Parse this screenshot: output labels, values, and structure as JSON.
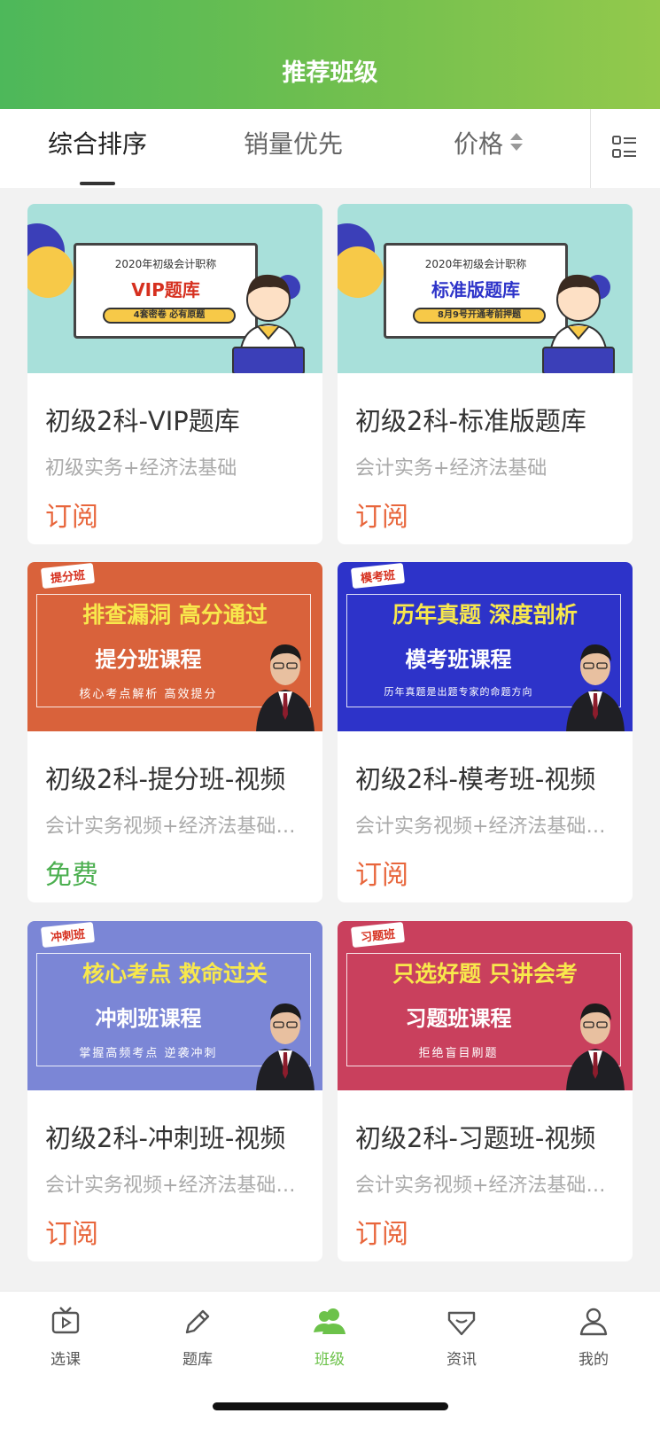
{
  "header": {
    "title": "推荐班级"
  },
  "tabs": [
    {
      "label": "综合排序"
    },
    {
      "label": "销量优先"
    },
    {
      "label": "价格"
    }
  ],
  "cards": [
    {
      "title": "初级2科-VIP题库",
      "subtitle": "初级实务+经济法基础",
      "price": "订阅",
      "thumb": {
        "line1": "2020年初级会计职称",
        "line2": "VIP题库",
        "line3": "4套密卷 必有原题"
      }
    },
    {
      "title": "初级2科-标准版题库",
      "subtitle": "会计实务+经济法基础",
      "price": "订阅",
      "thumb": {
        "line1": "2020年初级会计职称",
        "line2": "标准版题库",
        "line3": "8月9号开通考前押题"
      }
    },
    {
      "title": "初级2科-提分班-视频",
      "subtitle": "会计实务视频+经济法基础视频",
      "price": "免费",
      "thumb": {
        "tag": "提分班",
        "headline": "排查漏洞 高分通过",
        "course": "提分班课程",
        "small": "核心考点解析 高效提分",
        "bg": "#d9623b"
      }
    },
    {
      "title": "初级2科-模考班-视频",
      "subtitle": "会计实务视频+经济法基础视频",
      "price": "订阅",
      "thumb": {
        "tag": "模考班",
        "headline": "历年真题 深度剖析",
        "course": "模考班课程",
        "small": "历年真题是出题专家的命题方向",
        "bg": "#2d33c9"
      }
    },
    {
      "title": "初级2科-冲刺班-视频",
      "subtitle": "会计实务视频+经济法基础视频",
      "price": "订阅",
      "thumb": {
        "tag": "冲刺班",
        "headline": "核心考点 救命过关",
        "course": "冲刺班课程",
        "small": "掌握高频考点 逆袭冲刺",
        "bg": "#7b86d6"
      }
    },
    {
      "title": "初级2科-习题班-视频",
      "subtitle": "会计实务视频+经济法基础视频",
      "price": "订阅",
      "thumb": {
        "tag": "习题班",
        "headline": "只选好题 只讲会考",
        "course": "习题班课程",
        "small": "拒绝盲目刷题",
        "bg": "#c9405d"
      }
    }
  ],
  "bottom_nav": [
    {
      "label": "选课",
      "icon": "tv-icon"
    },
    {
      "label": "题库",
      "icon": "pencil-icon"
    },
    {
      "label": "班级",
      "icon": "group-icon",
      "active": true
    },
    {
      "label": "资讯",
      "icon": "diamond-icon"
    },
    {
      "label": "我的",
      "icon": "user-icon"
    }
  ],
  "colors": {
    "accent_green": "#6cc24a",
    "price_orange": "#e8663c",
    "free_green": "#4caf50"
  }
}
